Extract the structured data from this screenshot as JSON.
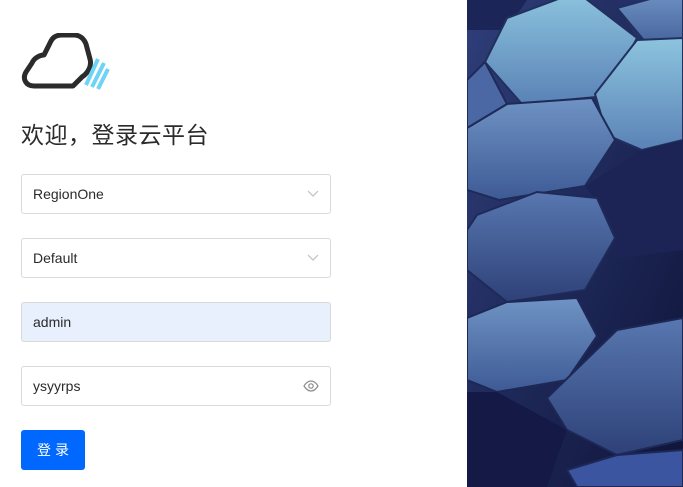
{
  "page": {
    "title": "欢迎，登录云平台"
  },
  "form": {
    "region": {
      "value": "RegionOne"
    },
    "domain": {
      "value": "Default"
    },
    "username": {
      "value": "admin"
    },
    "password": {
      "value": "ysyyrps"
    },
    "submit_label": "登录"
  },
  "icons": {
    "logo": "cloud-logo-icon",
    "region_dropdown": "chevron-down-icon",
    "domain_dropdown": "chevron-down-icon",
    "password_toggle": "eye-icon"
  },
  "colors": {
    "primary": "#0068ff",
    "autofill_bg": "#e8f0fe",
    "logo_dark": "#2b2b2b",
    "logo_accent": "#6fd3f7"
  },
  "decor": {
    "background_image": "hexagon-pattern"
  }
}
